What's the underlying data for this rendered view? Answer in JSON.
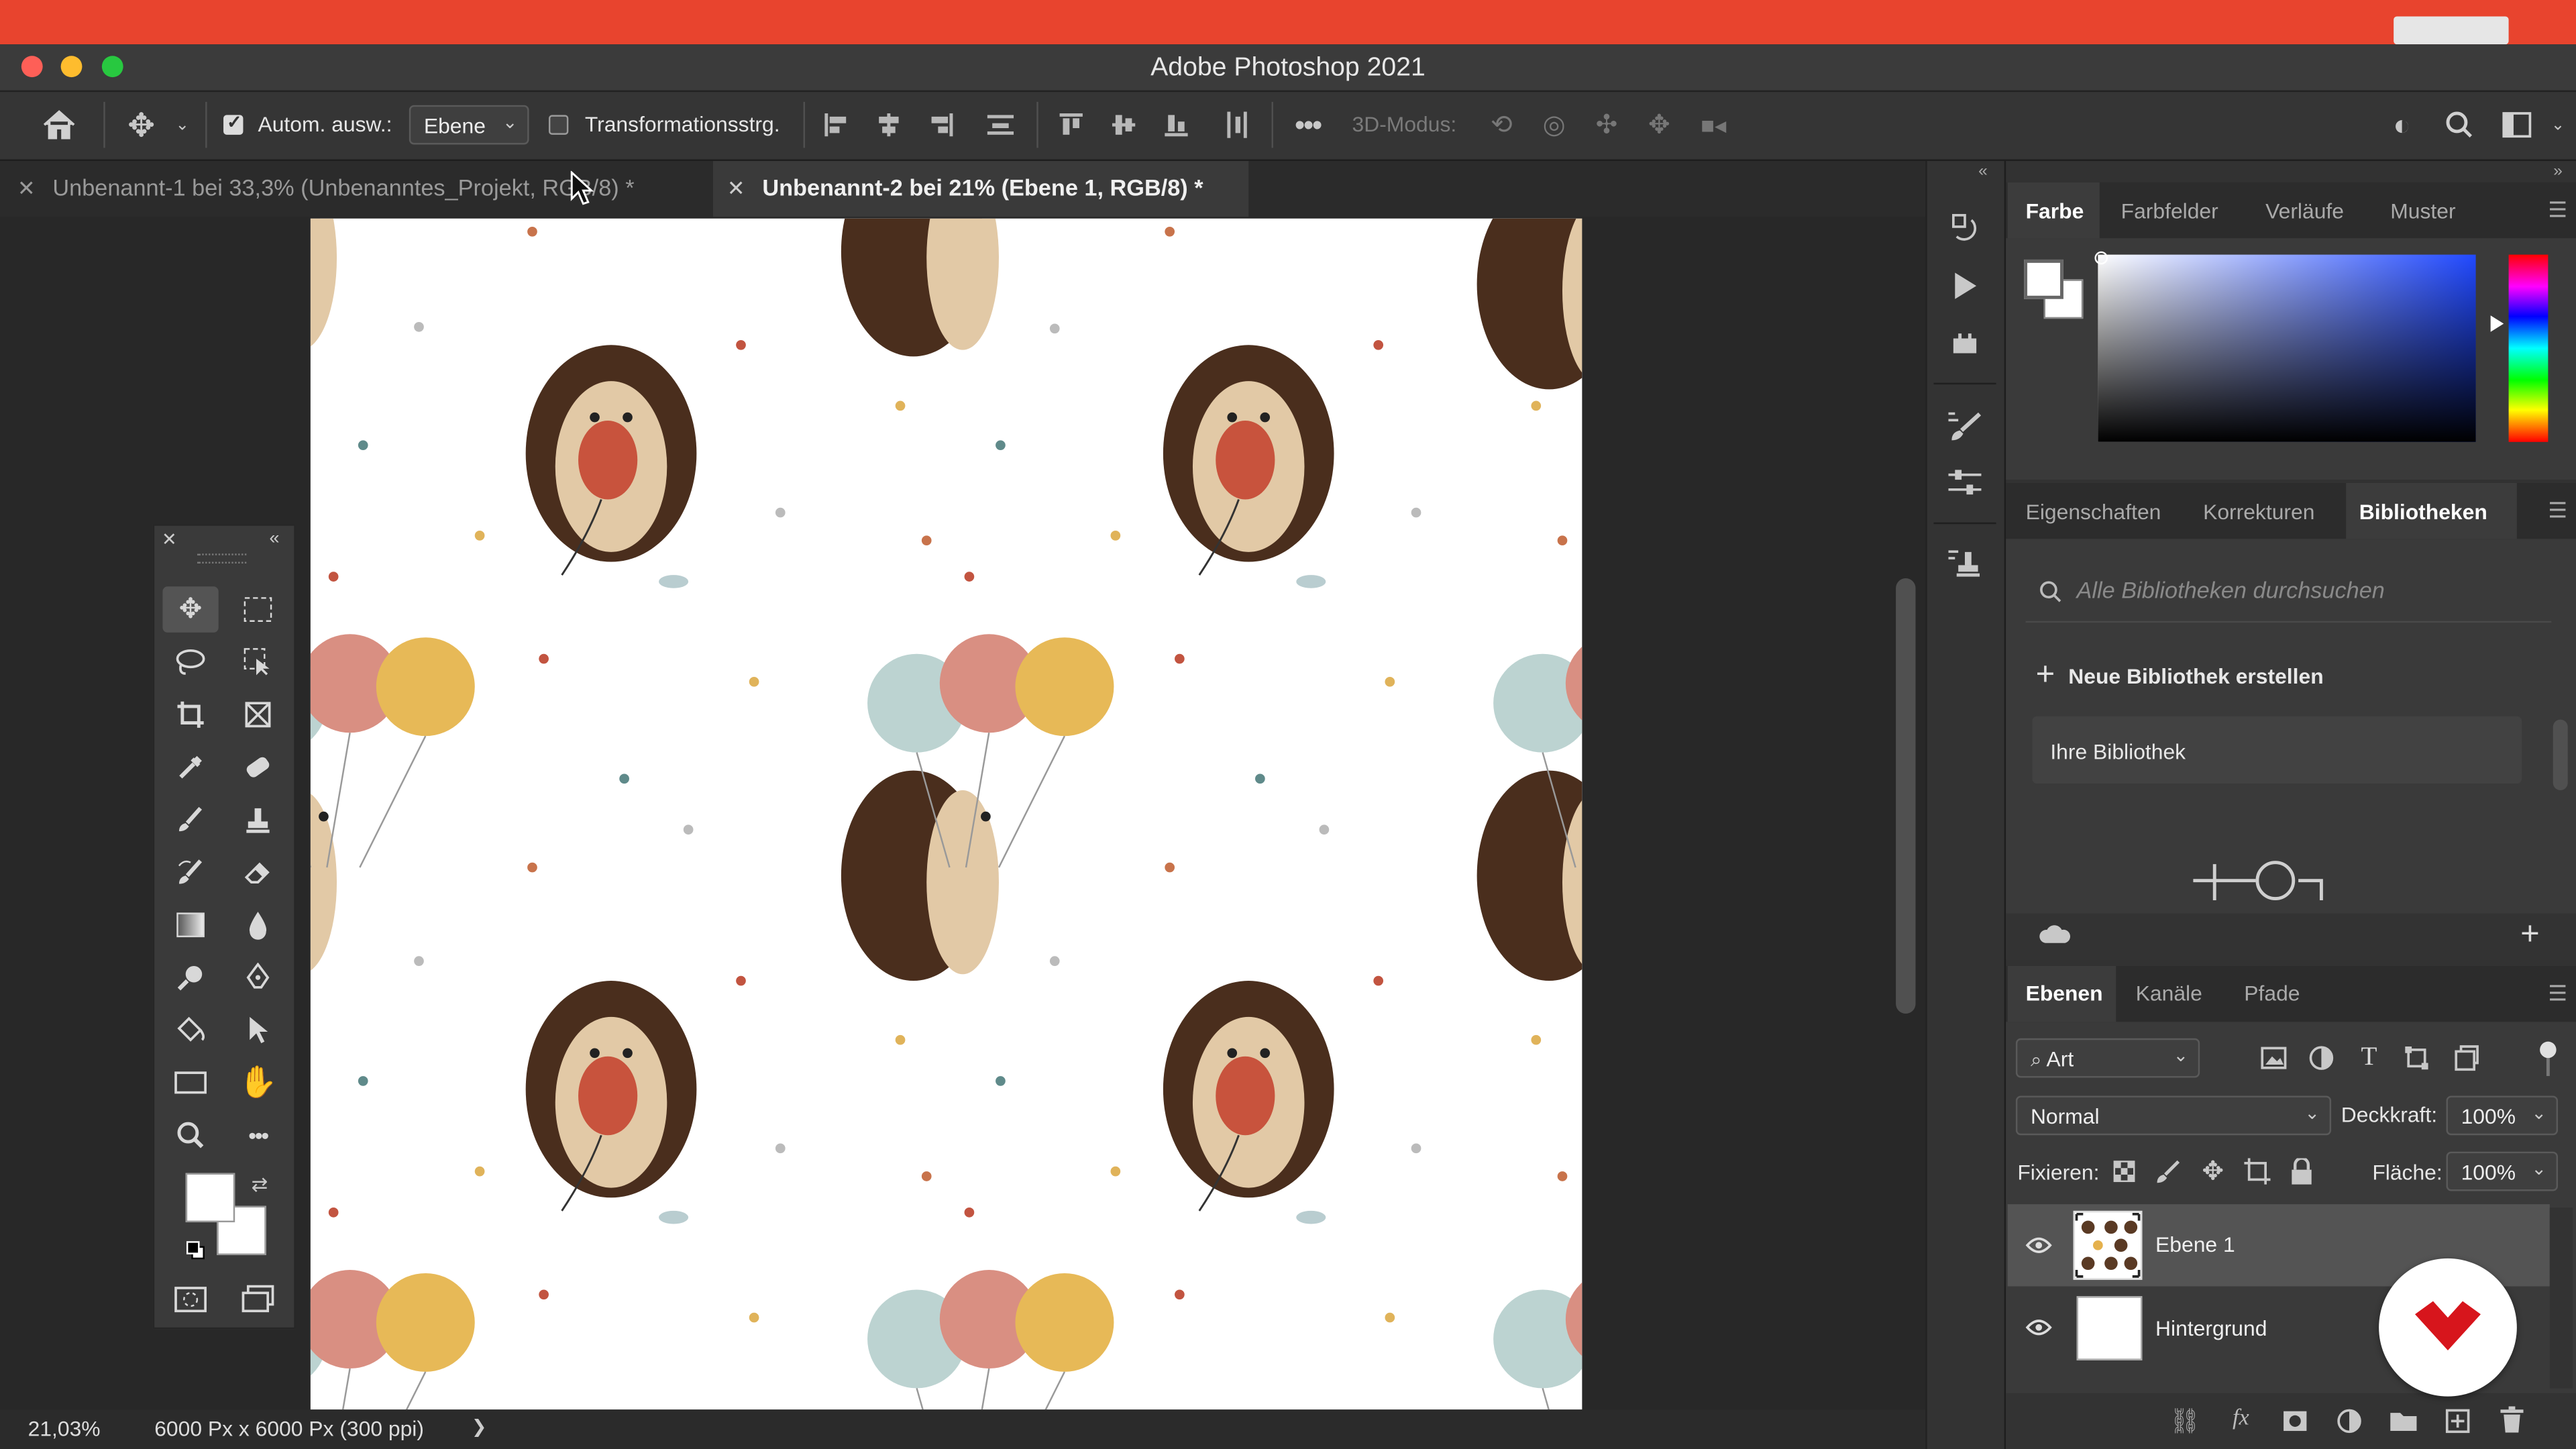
{
  "window": {
    "title": "Adobe Photoshop 2021"
  },
  "options_bar": {
    "auto_select_label": "Autom. ausw.:",
    "auto_select_value": "Ebene",
    "transform_label": "Transformationsstrg.",
    "mode_3d_label": "3D-Modus:"
  },
  "tabs": [
    {
      "label": "Unbenannt-1 bei 33,3% (Unbenanntes_Projekt, RGB/8) *",
      "active": false
    },
    {
      "label": "Unbenannt-2 bei 21% (Ebene 1, RGB/8) *",
      "active": true
    }
  ],
  "status": {
    "zoom": "21,03%",
    "doc_info": "6000 Px x 6000 Px (300 ppi)",
    "arrow": "❯"
  },
  "color_panel": {
    "tabs": [
      "Farbe",
      "Farbfelder",
      "Verläufe",
      "Muster"
    ]
  },
  "library_panel": {
    "tabs": [
      "Eigenschaften",
      "Korrekturen",
      "Bibliotheken"
    ],
    "search_placeholder": "Alle Bibliotheken durchsuchen",
    "new_library": "Neue Bibliothek erstellen",
    "your_library": "Ihre Bibliothek"
  },
  "layers_panel": {
    "tabs": [
      "Ebenen",
      "Kanäle",
      "Pfade"
    ],
    "filter_label": "Art",
    "blend_mode": "Normal",
    "opacity_label": "Deckkraft:",
    "opacity_value": "100%",
    "lock_label": "Fixieren:",
    "fill_label": "Fläche:",
    "fill_value": "100%",
    "layers": [
      {
        "name": "Ebene 1",
        "selected": true
      },
      {
        "name": "Hintergrund",
        "selected": false
      }
    ]
  },
  "colors": {
    "accent_red": "#e8442e",
    "logo_red": "#d7151c"
  }
}
